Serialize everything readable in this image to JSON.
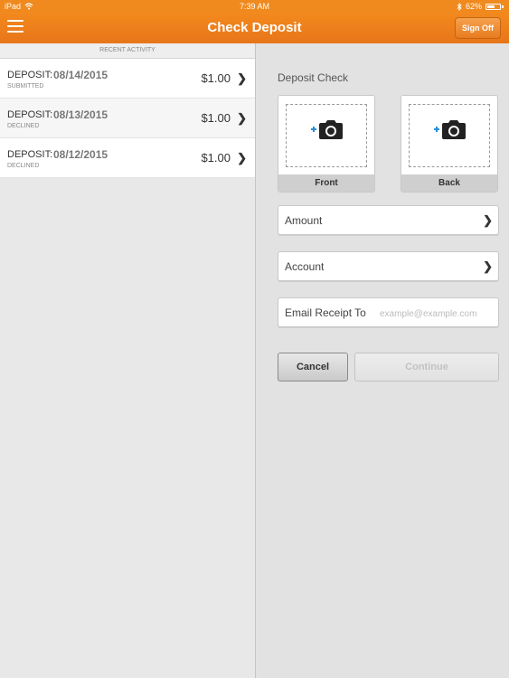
{
  "status_bar": {
    "device": "iPad",
    "time": "7:39 AM",
    "battery_text": "62%",
    "battery_level": 0.62
  },
  "header": {
    "title": "Check Deposit",
    "sign_off_label": "Sign Off",
    "accent_color": "#f08a1e"
  },
  "recent_activity": {
    "heading": "RECENT ACTIVITY",
    "items": [
      {
        "type": "DEPOSIT:",
        "date": "08/14/2015",
        "status": "SUBMITTED",
        "amount": "$1.00"
      },
      {
        "type": "DEPOSIT:",
        "date": "08/13/2015",
        "status": "DECLINED",
        "amount": "$1.00"
      },
      {
        "type": "DEPOSIT:",
        "date": "08/12/2015",
        "status": "DECLINED",
        "amount": "$1.00"
      }
    ]
  },
  "deposit_form": {
    "title": "Deposit Check",
    "front_label": "Front",
    "back_label": "Back",
    "amount_label": "Amount",
    "account_label": "Account",
    "email_label": "Email Receipt To",
    "email_placeholder": "example@example.com",
    "email_value": "",
    "cancel_label": "Cancel",
    "continue_label": "Continue"
  },
  "icons": {
    "menu": "hamburger-icon",
    "chevron": "chevron-right-icon",
    "camera": "add-camera-icon",
    "wifi": "wifi-icon",
    "bluetooth": "bluetooth-icon",
    "battery": "battery-icon"
  }
}
